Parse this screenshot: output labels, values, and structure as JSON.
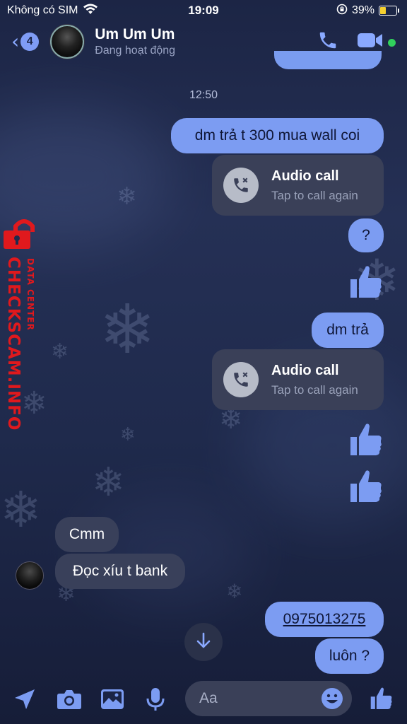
{
  "status_bar": {
    "carrier": "Không có SIM",
    "time": "19:09",
    "battery": "39%"
  },
  "header": {
    "back_count": "4",
    "contact_name": "Um Um Um",
    "contact_status": "Đang hoạt động"
  },
  "chat": {
    "time_divider": "12:50",
    "messages": [
      {
        "type": "text",
        "direction": "out",
        "text": "dm trả t 300 mua wall coi"
      },
      {
        "type": "call",
        "title": "Audio call",
        "subtitle": "Tap to call again"
      },
      {
        "type": "text",
        "direction": "out",
        "text": "?"
      },
      {
        "type": "like",
        "direction": "out"
      },
      {
        "type": "text",
        "direction": "out",
        "text": "dm trả"
      },
      {
        "type": "call",
        "title": "Audio call",
        "subtitle": "Tap to call again"
      },
      {
        "type": "like",
        "direction": "out"
      },
      {
        "type": "like",
        "direction": "out"
      },
      {
        "type": "text",
        "direction": "in",
        "text": "Cmm"
      },
      {
        "type": "text",
        "direction": "in",
        "text": "Đọc xíu t bank"
      },
      {
        "type": "text",
        "direction": "out",
        "text": "0975013275"
      },
      {
        "type": "text",
        "direction": "out",
        "text": "luôn ?"
      }
    ]
  },
  "watermark": {
    "main": "CHECKSCAM.INFO",
    "sub": "DATA CENTER"
  },
  "composer": {
    "placeholder": "Aa"
  },
  "colors": {
    "accent": "#7c9cf2",
    "incoming_bubble": "#39405a",
    "online": "#31d05c",
    "watermark": "#e0191d"
  },
  "icons": [
    "wifi-icon",
    "lock-rotation-icon",
    "battery-icon",
    "chevron-left-icon",
    "phone-icon",
    "video-icon",
    "missed-call-icon",
    "thumbs-up-icon",
    "arrow-down-icon",
    "send-location-icon",
    "camera-icon",
    "image-icon",
    "microphone-icon",
    "emoji-icon",
    "lock-icon"
  ]
}
